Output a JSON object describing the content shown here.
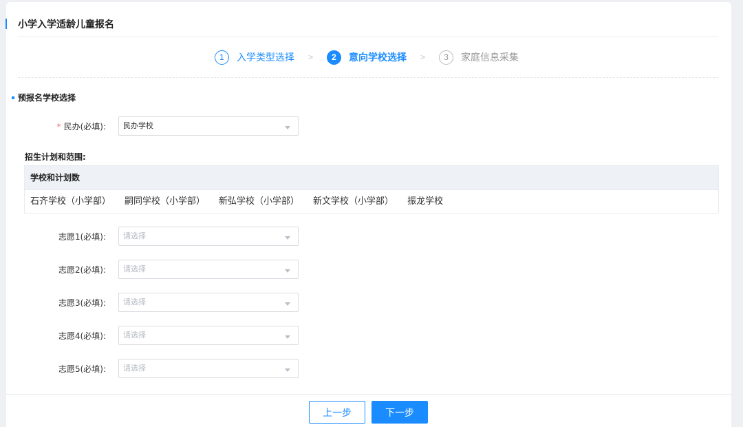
{
  "page": {
    "title": "小学入学适龄儿童报名"
  },
  "steps": [
    {
      "num": "1",
      "label": "入学类型选择",
      "state": "done"
    },
    {
      "num": "2",
      "label": "意向学校选择",
      "state": "active"
    },
    {
      "num": "3",
      "label": "家庭信息采集",
      "state": "todo"
    }
  ],
  "step_separator": ">",
  "section": {
    "title": "预报名学校选择"
  },
  "minban": {
    "required_mark": "*",
    "label": "民办(必填):",
    "value": "民办学校"
  },
  "plan": {
    "title": "招生计划和范围:",
    "table_header": "学校和计划数",
    "schools": [
      "石齐学校（小学部）",
      "嗣同学校（小学部）",
      "新弘学校（小学部）",
      "新文学校（小学部）",
      "振龙学校"
    ]
  },
  "choices": [
    {
      "label": "志愿1(必填):",
      "placeholder": "请选择"
    },
    {
      "label": "志愿2(必填):",
      "placeholder": "请选择"
    },
    {
      "label": "志愿3(必填):",
      "placeholder": "请选择"
    },
    {
      "label": "志愿4(必填):",
      "placeholder": "请选择"
    },
    {
      "label": "志愿5(必填):",
      "placeholder": "请选择"
    }
  ],
  "buttons": {
    "prev": "上一步",
    "next": "下一步"
  },
  "colors": {
    "primary": "#1a8cff",
    "required": "#f56c6c",
    "background": "#eef0f4"
  }
}
